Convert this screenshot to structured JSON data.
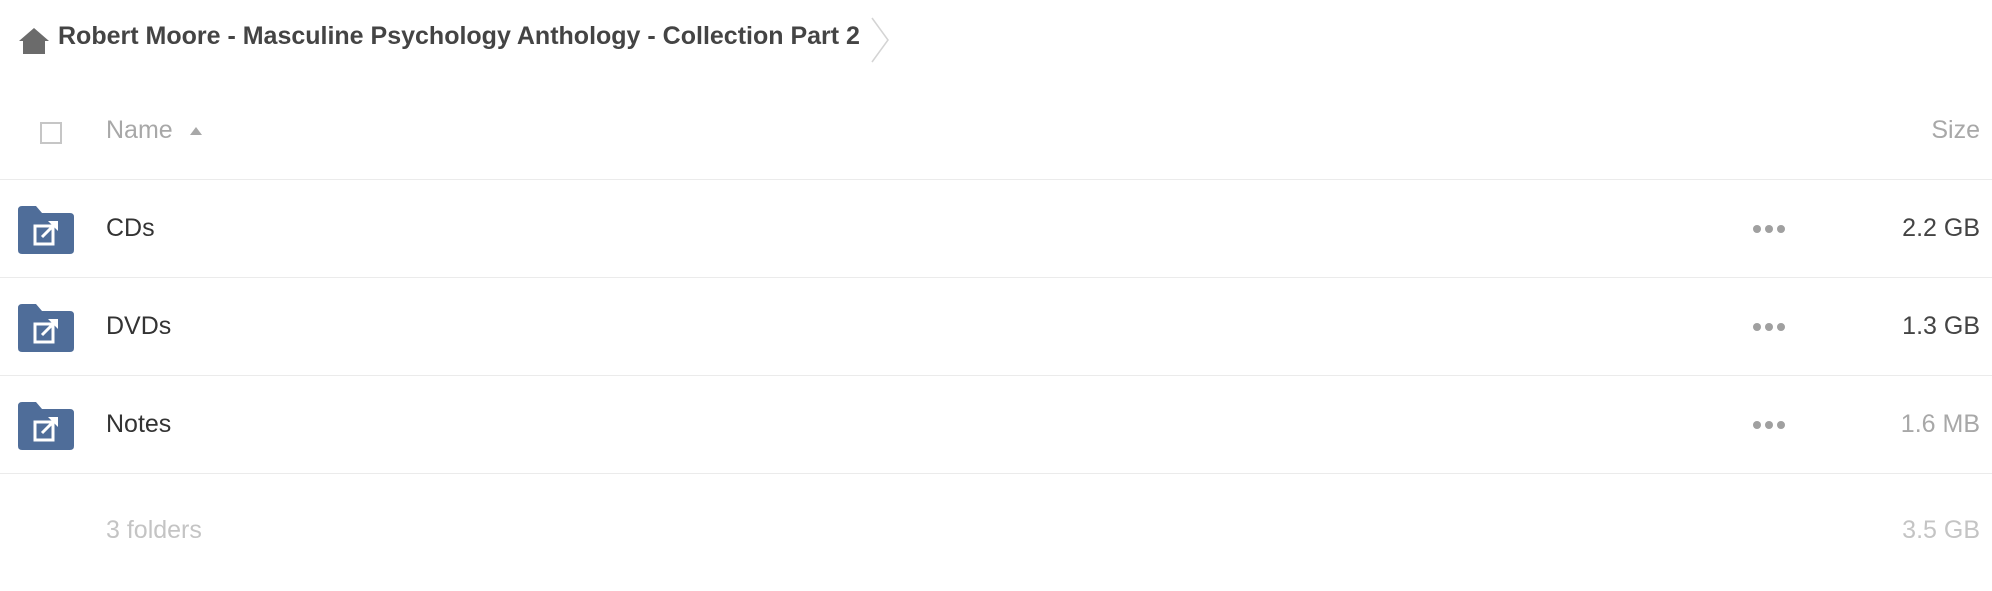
{
  "breadcrumb": {
    "home_icon": "home-icon",
    "title": "Robert Moore - Masculine Psychology Anthology - Collection Part 2",
    "separator_icon": "chevron-right-icon"
  },
  "table": {
    "header": {
      "name_label": "Name",
      "sort_icon": "sort-ascending-icon",
      "size_label": "Size"
    },
    "rows": [
      {
        "icon": "shared-folder-icon",
        "name": "CDs",
        "more_icon": "more-icon",
        "size": "2.2 GB"
      },
      {
        "icon": "shared-folder-icon",
        "name": "DVDs",
        "more_icon": "more-icon",
        "size": "1.3 GB"
      },
      {
        "icon": "shared-folder-icon",
        "name": "Notes",
        "more_icon": "more-icon",
        "size": "1.6 MB"
      }
    ],
    "summary": {
      "count": "3 folders",
      "total_size": "3.5 GB"
    }
  },
  "colors": {
    "folder": "#4f6d99",
    "home_icon": "#6b6b6b",
    "muted_text": "#a8a8a8",
    "row_divider": "#ebebeb"
  }
}
